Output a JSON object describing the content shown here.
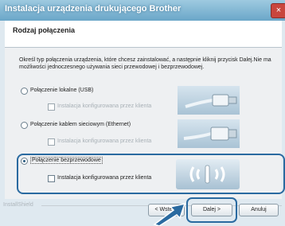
{
  "window": {
    "title": "Instalacja urządzenia drukującego Brother",
    "close_label": "×"
  },
  "header": {
    "title": "Rodzaj połączenia"
  },
  "description": "Określ typ połączenia urządzenia, które chcesz zainstalować, a następnie kliknij przycisk Dalej.Nie ma możliwości jednoczesnego używania sieci przewodowej i bezprzewodowej.",
  "options": [
    {
      "label": "Połączenie lokalne (USB)",
      "sub_label": "Instalacja konfigurowana przez klienta",
      "selected": false
    },
    {
      "label": "Połączenie kablem sieciowym (Ethernet)",
      "sub_label": "Instalacja konfigurowana przez klienta",
      "selected": false
    },
    {
      "label": "Połączenie bezprzewodowe",
      "sub_label": "Instalacja konfigurowana przez klienta",
      "selected": true
    }
  ],
  "footer": {
    "installshield": "InstallShield",
    "back_label": "< Wstecz",
    "next_label": "Dalej >",
    "cancel_label": "Anuluj"
  },
  "colors": {
    "highlight": "#2a6aa0",
    "titlebar": "#6aa6c8"
  }
}
